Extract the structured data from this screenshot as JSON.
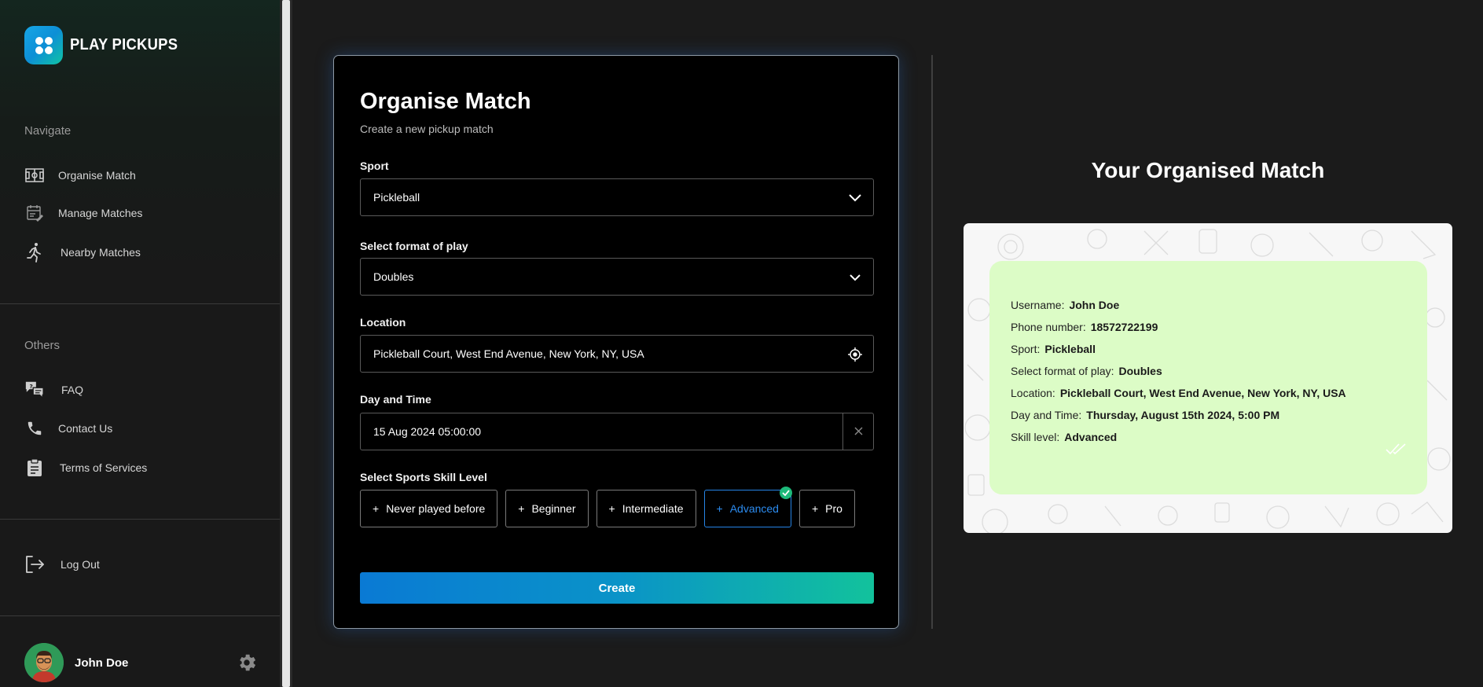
{
  "brand": {
    "name": "PLAY PICKUPS"
  },
  "sidebar": {
    "navigate_title": "Navigate",
    "navigate_items": [
      {
        "label": "Organise Match",
        "icon": "field-icon"
      },
      {
        "label": "Manage Matches",
        "icon": "calendar-edit-icon"
      },
      {
        "label": "Nearby Matches",
        "icon": "running-person-icon"
      }
    ],
    "others_title": "Others",
    "others_items": [
      {
        "label": "FAQ",
        "icon": "faq-chat-icon"
      },
      {
        "label": "Contact Us",
        "icon": "phone-icon"
      },
      {
        "label": "Terms of Services",
        "icon": "clipboard-icon"
      }
    ],
    "logout_label": "Log Out",
    "user_name": "John Doe"
  },
  "form": {
    "title": "Organise Match",
    "subtitle": "Create a new pickup match",
    "sport_label": "Sport",
    "sport_value": "Pickleball",
    "format_label": "Select format of play",
    "format_value": "Doubles",
    "location_label": "Location",
    "location_value": "Pickleball Court, West End Avenue, New York, NY, USA",
    "datetime_label": "Day and Time",
    "datetime_value": "15 Aug 2024 05:00:00",
    "skill_label": "Select Sports Skill Level",
    "skill_levels": [
      "Never played before",
      "Beginner",
      "Intermediate",
      "Advanced",
      "Pro"
    ],
    "selected_skill": "Advanced",
    "create_label": "Create"
  },
  "preview": {
    "title": "Your Organised Match",
    "rows": [
      {
        "key": "Username:",
        "value": "John Doe"
      },
      {
        "key": "Phone number:",
        "value": "18572722199"
      },
      {
        "key": "Sport:",
        "value": "Pickleball"
      },
      {
        "key": "Select format of play:",
        "value": "Doubles"
      },
      {
        "key": "Location:",
        "value": "Pickleball Court, West End Avenue, New York, NY, USA"
      },
      {
        "key": "Day and Time:",
        "value": "Thursday, August 15th 2024, 5:00 PM"
      },
      {
        "key": "Skill level:",
        "value": "Advanced"
      }
    ]
  },
  "colors": {
    "accent_blue": "#2c8cf0",
    "accent_green": "#12c29c",
    "bubble_green": "#dcfcc6"
  }
}
